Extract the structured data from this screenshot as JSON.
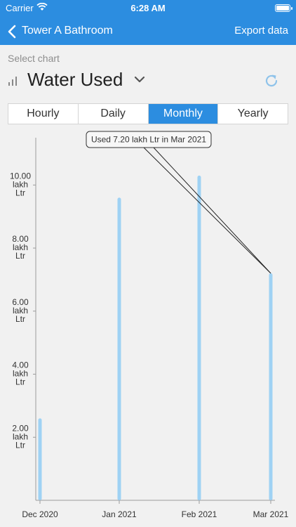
{
  "status_bar": {
    "carrier": "Carrier",
    "time": "6:28 AM"
  },
  "nav": {
    "title": "Tower A Bathroom",
    "export_label": "Export data"
  },
  "select_label": "Select chart",
  "chart_selector": {
    "selected": "Water Used"
  },
  "tabs": [
    {
      "label": "Hourly",
      "active": false
    },
    {
      "label": "Daily",
      "active": false
    },
    {
      "label": "Monthly",
      "active": true
    },
    {
      "label": "Yearly",
      "active": false
    }
  ],
  "colors": {
    "accent": "#2c8de0",
    "bar": "#9fd2f4",
    "background": "#f1f1f1"
  },
  "chart_data": {
    "type": "bar",
    "categories": [
      "Dec 2020",
      "Jan 2021",
      "Feb 2021",
      "Mar 2021"
    ],
    "values": [
      2.6,
      9.6,
      10.3,
      7.2
    ],
    "unit": "lakh Ltr",
    "ylim": [
      0,
      11.5
    ],
    "y_ticks": [
      {
        "value": 2,
        "label": [
          "2.00",
          "lakh",
          "Ltr"
        ]
      },
      {
        "value": 4,
        "label": [
          "4.00",
          "lakh",
          "Ltr"
        ]
      },
      {
        "value": 6,
        "label": [
          "6.00",
          "lakh",
          "Ltr"
        ]
      },
      {
        "value": 8,
        "label": [
          "8.00",
          "lakh",
          "Ltr"
        ]
      },
      {
        "value": 10,
        "label": [
          "10.00",
          "lakh",
          "Ltr"
        ]
      }
    ],
    "grid": false,
    "tooltip": {
      "text": "Used 7.20 lakh Ltr in Mar 2021",
      "category_index": 3
    }
  }
}
